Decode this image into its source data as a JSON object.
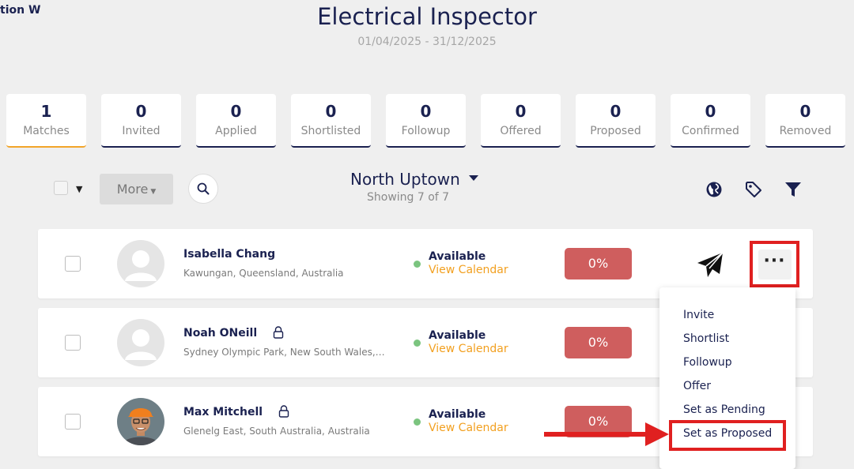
{
  "breadcrumb": "tion W",
  "header": {
    "title": "Electrical Inspector",
    "dates": "01/04/2025 - 31/12/2025"
  },
  "stats": [
    {
      "count": "1",
      "label": "Matches"
    },
    {
      "count": "0",
      "label": "Invited"
    },
    {
      "count": "0",
      "label": "Applied"
    },
    {
      "count": "0",
      "label": "Shortlisted"
    },
    {
      "count": "0",
      "label": "Followup"
    },
    {
      "count": "0",
      "label": "Offered"
    },
    {
      "count": "0",
      "label": "Proposed"
    },
    {
      "count": "0",
      "label": "Confirmed"
    },
    {
      "count": "0",
      "label": "Removed"
    }
  ],
  "toolbar": {
    "more_label": "More",
    "location": "North Uptown",
    "showing": "Showing 7 of 7"
  },
  "candidates": [
    {
      "name": "Isabella Chang",
      "address": "Kawungan, Queensland, Australia",
      "status": "Available",
      "calendar": "View Calendar",
      "score": "0%"
    },
    {
      "name": "Noah ONeill",
      "address": "Sydney Olympic Park, New South Wales, Australia",
      "status": "Available",
      "calendar": "View Calendar",
      "score": "0%"
    },
    {
      "name": "Max Mitchell",
      "address": "Glenelg East, South Australia, Australia",
      "status": "Available",
      "calendar": "View Calendar",
      "score": "0%"
    }
  ],
  "menu": {
    "items": [
      "Invite",
      "Shortlist",
      "Followup",
      "Offer",
      "Set as Pending",
      "Set as Proposed"
    ]
  },
  "colors": {
    "accent": "#f2a52a",
    "navy": "#1a2150",
    "score_bg": "#cf5e5e",
    "highlight": "#e02020",
    "available": "#7bc47f"
  },
  "icons": [
    "search-icon",
    "globe-icon",
    "tag-icon",
    "filter-icon",
    "send-icon",
    "more-icon",
    "lock-icon",
    "user-placeholder-icon"
  ]
}
